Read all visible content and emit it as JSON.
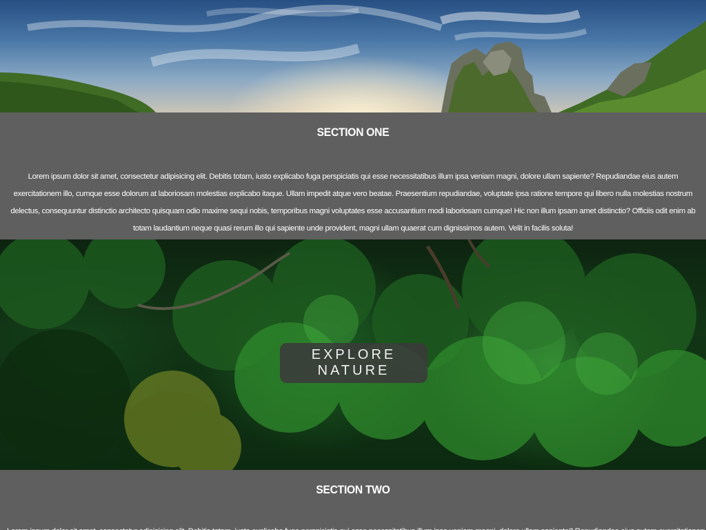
{
  "hero": {
    "image_name": "mountain-sunset-landscape"
  },
  "section_one": {
    "title": "SECTION ONE",
    "body": "Lorem ipsum dolor sit amet, consectetur adipisicing elit. Debitis totam, iusto explicabo fuga perspiciatis qui esse necessitatibus illum ipsa veniam magni, dolore ullam sapiente? Repudiandae eius autem exercitationem illo, cumque esse dolorum at laboriosam molestias explicabo itaque. Ullam impedit atque vero beatae. Praesentium repudiandae, voluptate ipsa ratione tempore qui libero nulla molestias nostrum delectus, consequuntur distinctio architecto quisquam odio maxime sequi nobis, temporibus magni voluptates esse accusantium modi laboriosam cumque! Hic non illum ipsam amet distinctio? Officiis odit enim ab totam laudantium neque quasi rerum illo qui sapiente unde provident, magni ullam quaerat cum dignissimos autem. Velit in facilis soluta!"
  },
  "forest": {
    "image_name": "rainforest-canopy",
    "button_label": "EXPLORE NATURE"
  },
  "section_two": {
    "title": "SECTION TWO",
    "body": "Lorem ipsum dolor sit amet, consectetur adipisicing elit. Debitis totam, iusto explicabo fuga perspiciatis qui esse necessitatibus illum ipsa veniam magni, dolore ullam sapiente? Repudiandae eius autem exercitationem illo, cumque esse dolorum at laboriosam"
  },
  "colors": {
    "section_background": "#5f5f5f",
    "text": "#ffffff",
    "button_background": "#3a3a3a"
  }
}
